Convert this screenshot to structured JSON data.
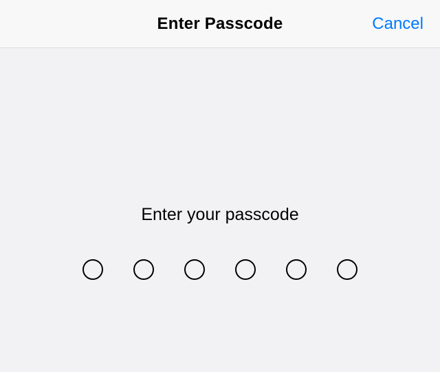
{
  "header": {
    "title": "Enter Passcode",
    "cancel_label": "Cancel"
  },
  "content": {
    "prompt": "Enter your passcode",
    "passcode_length": 6,
    "filled": [
      false,
      false,
      false,
      false,
      false,
      false
    ]
  },
  "colors": {
    "accent": "#007aff",
    "background": "#f2f2f4",
    "header_bg": "#f8f8f9",
    "divider": "#dcdcdd"
  }
}
